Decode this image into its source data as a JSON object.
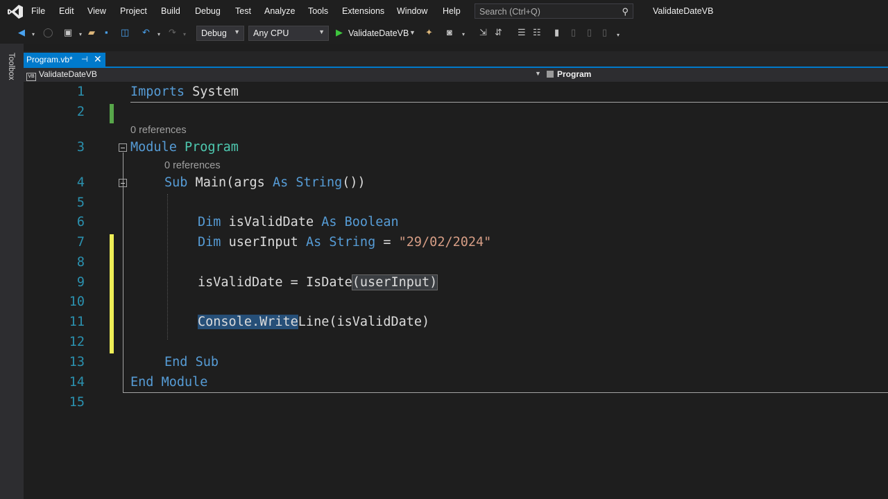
{
  "menubar": {
    "items": [
      "File",
      "Edit",
      "View",
      "Project",
      "Build",
      "Debug",
      "Test",
      "Analyze",
      "Tools",
      "Extensions",
      "Window",
      "Help"
    ],
    "search_placeholder": "Search (Ctrl+Q)",
    "solution_name": "ValidateDateVB"
  },
  "toolbar": {
    "configuration": "Debug",
    "platform": "Any CPU",
    "start_label": "ValidateDateVB"
  },
  "toolbox": {
    "label": "Toolbox"
  },
  "tab": {
    "name": "Program.vb*",
    "pin_glyph": "⊣",
    "close_glyph": "✕"
  },
  "navbar": {
    "project": "ValidateDateVB",
    "class": "Program"
  },
  "colors": {
    "accent": "#007acc",
    "keyword": "#569cd6",
    "type": "#4ec9b0",
    "string": "#d69d85",
    "line_number": "#2b91af",
    "change_saved": "#57a64a",
    "change_unsaved": "#efef57"
  },
  "editor": {
    "line_numbers": [
      "1",
      "2",
      "3",
      "4",
      "5",
      "6",
      "7",
      "8",
      "9",
      "10",
      "11",
      "12",
      "13",
      "14",
      "15"
    ],
    "references": [
      "0 references",
      "0 references"
    ],
    "tokens": {
      "imports": "Imports",
      "system": "System",
      "module": "Module",
      "program": "Program",
      "sub": "Sub",
      "main": "Main",
      "args_open": "(args",
      "as": "As",
      "string_arr": "String",
      "arr_close": "())",
      "dim": "Dim",
      "isValidDate": "isValidDate",
      "boolean": "Boolean",
      "userInput": "userInput",
      "string_t": "String",
      "eq": "=",
      "date_literal": "\"29/02/2024\"",
      "isValidDate_assign": "isValidDate",
      "isdate": "IsDate",
      "isdate_arg": "(userInput)",
      "console": "Console.Write",
      "writeline_rest": "Line",
      "writeline_arg": "(isValidDate)",
      "end_sub_end": "End",
      "end_sub_sub": "Sub",
      "end_module_end": "End",
      "end_module_module": "Module"
    }
  }
}
